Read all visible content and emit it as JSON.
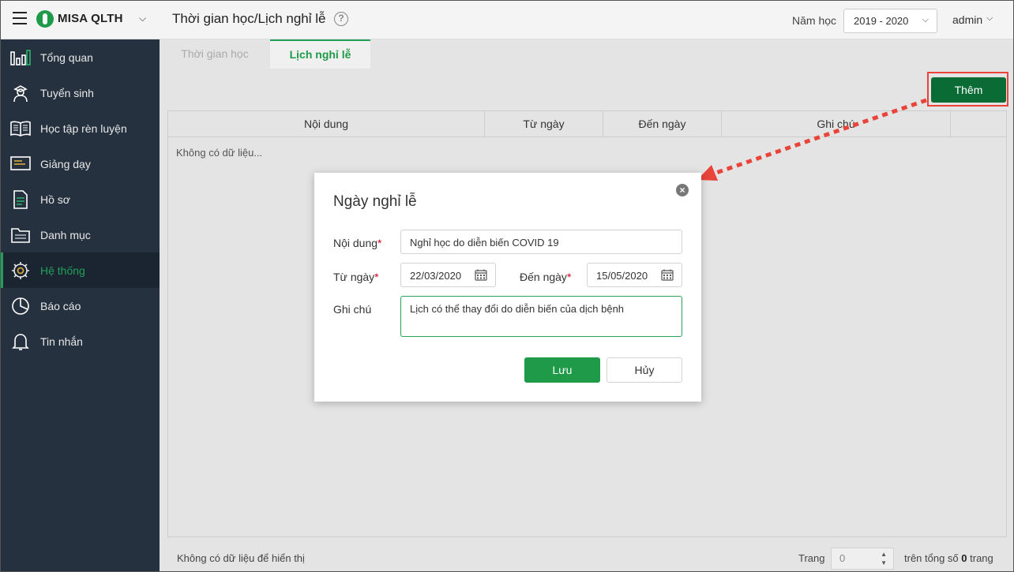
{
  "header": {
    "logo_text": "MISA QLTH",
    "page_title": "Thời gian học/Lịch nghỉ lễ",
    "help_glyph": "?",
    "year_label": "Năm học",
    "year_value": "2019 - 2020",
    "user": "admin"
  },
  "sidebar": {
    "items": [
      {
        "label": "Tổng quan",
        "icon": "chart-icon"
      },
      {
        "label": "Tuyển sinh",
        "icon": "student-icon"
      },
      {
        "label": "Học tập rèn luyện",
        "icon": "book-icon"
      },
      {
        "label": "Giảng dạy",
        "icon": "board-icon"
      },
      {
        "label": "Hồ sơ",
        "icon": "document-icon"
      },
      {
        "label": "Danh mục",
        "icon": "folder-icon"
      },
      {
        "label": "Hệ thống",
        "icon": "gear-icon",
        "active": true
      },
      {
        "label": "Báo cáo",
        "icon": "pie-chart-icon"
      },
      {
        "label": "Tin nhắn",
        "icon": "bell-icon"
      }
    ]
  },
  "tabs": [
    {
      "label": "Thời gian học"
    },
    {
      "label": "Lịch nghỉ lễ",
      "active": true
    }
  ],
  "toolbar": {
    "add_label": "Thêm"
  },
  "grid": {
    "columns": [
      "Nội dung",
      "Từ ngày",
      "Đến ngày",
      "Ghi chú"
    ],
    "empty_text": "Không có dữ liệu..."
  },
  "footer": {
    "status": "Không có dữ liệu để hiển thị",
    "page_label": "Trang",
    "page_value": "0",
    "total_prefix": "trên tổng số",
    "total_value": "0",
    "total_suffix": "trang"
  },
  "dialog": {
    "title": "Ngày nghỉ lễ",
    "close_glyph": "×",
    "content_label": "Nội dung",
    "content_value": "Nghỉ học do diễn biến COVID 19",
    "from_label": "Từ ngày",
    "from_value": "22/03/2020",
    "to_label": "Đến ngày",
    "to_value": "15/05/2020",
    "note_label": "Ghi chú",
    "note_value": "Lịch có thể thay đổi do diễn biến của dịch bệnh",
    "required_mark": "*",
    "save_label": "Lưu",
    "cancel_label": "Hủy"
  },
  "colors": {
    "accent": "#1e9a48",
    "sidebar_bg": "#26313f",
    "highlight": "#e8443a"
  }
}
